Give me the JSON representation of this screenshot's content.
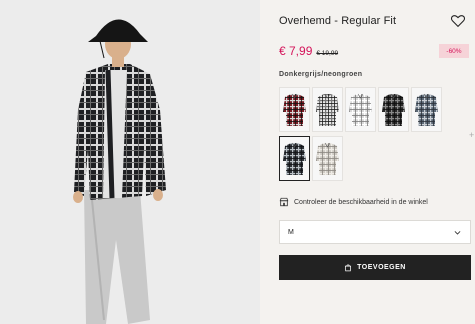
{
  "product": {
    "title": "Overhemd - Regular Fit",
    "price": "€ 7,99",
    "old_price": "€ 19,99",
    "discount": "-60%",
    "color_label": "Donkergrijs/neongroen"
  },
  "swatches": [
    {
      "name": "Rood geruit",
      "base": "#7a1c24",
      "line": "#111111",
      "accent": "#d8d8d8"
    },
    {
      "name": "Zwart/wit geruit",
      "base": "#e8e8e8",
      "line": "#1a1a1a",
      "accent": "#777777"
    },
    {
      "name": "Lichtgrijs geruit",
      "base": "#d9d9d9",
      "line": "#7a7a7a",
      "accent": "#ffffff"
    },
    {
      "name": "Zwart geruit",
      "base": "#2a2a2a",
      "line": "#0d0d0d",
      "accent": "#8a8a8a"
    },
    {
      "name": "Grijs/blauw geruit",
      "base": "#5d6a78",
      "line": "#2b3038",
      "accent": "#c9ced4"
    },
    {
      "name": "Donkergrijs/neongroen",
      "base": "#2f3338",
      "line": "#101214",
      "accent": "#b9c0c6",
      "selected": true
    },
    {
      "name": "Beige geruit",
      "base": "#cfcbc4",
      "line": "#8a8680",
      "accent": "#efece7"
    }
  ],
  "store": {
    "label": "Controleer de beschikbaarheid in de winkel",
    "icon": "store-icon"
  },
  "size": {
    "value": "M",
    "icon": "chevron-down-icon"
  },
  "cart": {
    "label": "TOEVOEGEN",
    "icon": "bag-icon"
  },
  "favorite": {
    "icon": "heart-icon"
  }
}
